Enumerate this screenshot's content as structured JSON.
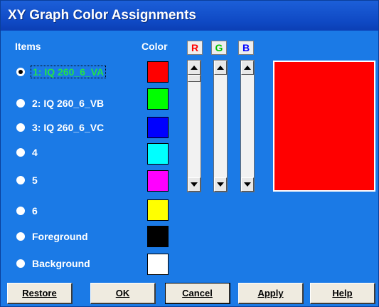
{
  "window": {
    "title": "XY Graph Color Assignments"
  },
  "headers": {
    "items": "Items",
    "color": "Color",
    "r": "R",
    "g": "G",
    "b": "B"
  },
  "items": [
    {
      "label": "1: IQ 260_6_VA",
      "color": "#ff0000",
      "selected": true
    },
    {
      "label": "2: IQ 260_6_VB",
      "color": "#00ff00",
      "selected": false
    },
    {
      "label": "3: IQ 260_6_VC",
      "color": "#0000ff",
      "selected": false
    },
    {
      "label": "4",
      "color": "#00ffff",
      "selected": false
    },
    {
      "label": "5",
      "color": "#ff00ff",
      "selected": false
    },
    {
      "label": "6",
      "color": "#ffff00",
      "selected": false
    },
    {
      "label": "Foreground",
      "color": "#000000",
      "selected": false
    },
    {
      "label": "Background",
      "color": "#ffffff",
      "selected": false
    }
  ],
  "preview": {
    "color": "#ff0000"
  },
  "buttons": {
    "restore": "Restore",
    "ok": "OK",
    "cancel": "Cancel",
    "apply": "Apply",
    "help": "Help"
  },
  "colors": {
    "dialog_bg": "#1b7ae6",
    "title_bg": "#0f49c4",
    "r_label": "#ff0000",
    "g_label": "#00c000",
    "b_label": "#0000ff"
  }
}
